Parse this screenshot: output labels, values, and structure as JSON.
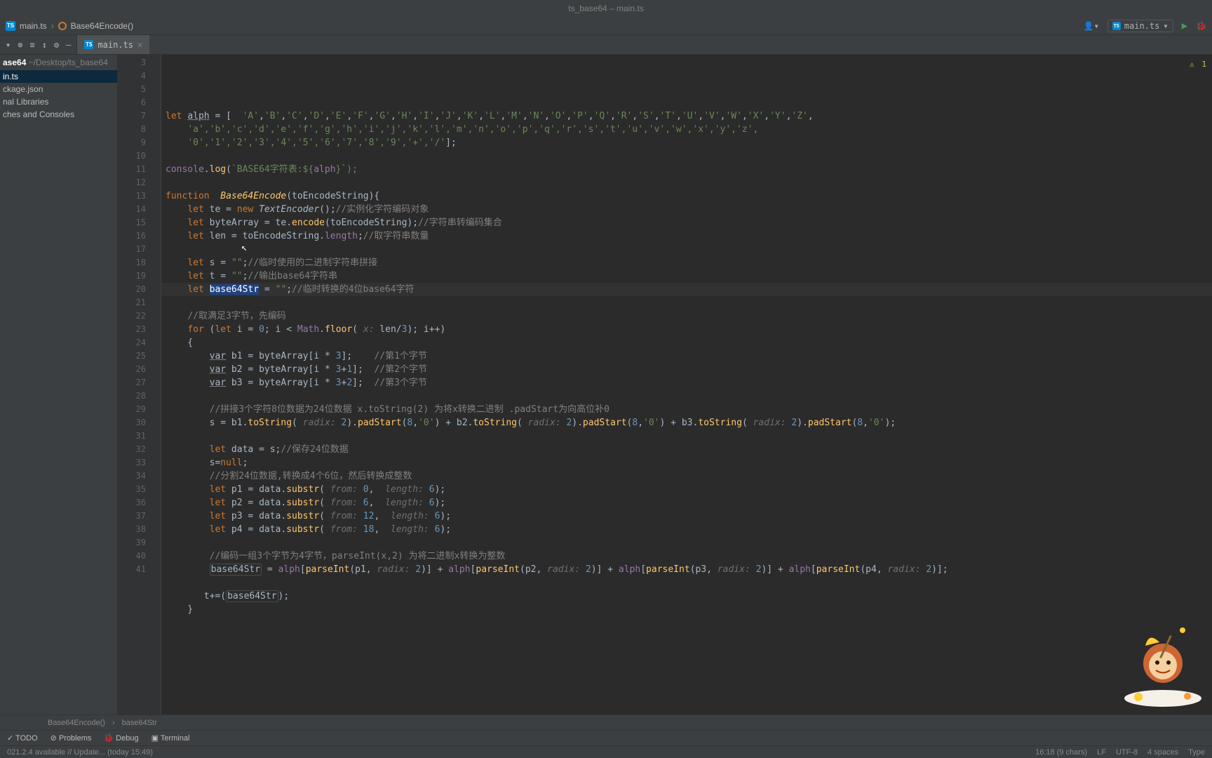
{
  "title": "ts_base64 – main.ts",
  "breadcrumb": {
    "file": "main.ts",
    "symbol": "Base64Encode()"
  },
  "run_config": "main.ts",
  "warning_count": "1",
  "sidebar": {
    "project": "ase64",
    "project_path": "~/Desktop/ts_base64",
    "items": [
      "in.ts",
      "ckage.json",
      "nal Libraries",
      "ches and Consoles"
    ],
    "selected": 0
  },
  "tab": {
    "label": "main.ts"
  },
  "lines": {
    "start": 3,
    "end": 41
  },
  "code": {
    "l3": "let alph = [  A , B , C , D , E , F , G , H , I , J , K , L , M , N , O , P , Q , R , S , T , U , V , W , X , Y , Z ,",
    "l4_str": "'a','b','c','d','e','f','g','h','i','j','k','l','m','n','o','p','q','r','s','t','u','v','w','x','y','z',",
    "l5_str": "'0','1','2','3','4','5','6','7','8','9','+','/'",
    "l7_log_str": "`BASE64字符表:${",
    "l7_var": "alph",
    "l7_end": "}`);",
    "l9_fn": "Base64Encode",
    "l9_arg": "toEncodeString",
    "l10_cm": "//实例化字符编码对象",
    "l11_cm": "//字符串转编码集合",
    "l12_cm": "//取字符串数量",
    "l14_cm": "//临时使用的二进制字符串拼接",
    "l15_cm": "//输出base64字符串",
    "l16_var": "base64Str",
    "l16_cm": "//临时转换的4位base64字符",
    "l18_cm": "//取满足3字节，先编码",
    "l21_cm": "//第1个字节",
    "l22_cm": "//第2个字节",
    "l23_cm": "//第3个字节",
    "l25_cm": "//拼接3个字符8位数据为24位数据 x.toString(2) 为将x转换二进制 .padStart为向高位补0",
    "l28_cm": "//保存24位数据",
    "l30_cm": "//分割24位数据,转换成4个6位，然后转换成整数",
    "l36_cm": "//编码一组3个字节为4字节，parseInt(x,2) 为将二进制x转换为整数",
    "radix_hint": "radix:",
    "from_hint": "from:",
    "length_hint": "length:",
    "x_hint": "x:"
  },
  "bc_footer": {
    "sym1": "Base64Encode()",
    "sym2": "base64Str"
  },
  "toolwindow": [
    "TODO",
    "Problems",
    "Debug",
    "Terminal"
  ],
  "status": {
    "left": "021.2.4 available // Update... (today 15:49)",
    "pos": "16:18 (9 chars)",
    "line_sep": "LF",
    "enc": "UTF-8",
    "indent": "4 spaces",
    "ext": "Type"
  }
}
